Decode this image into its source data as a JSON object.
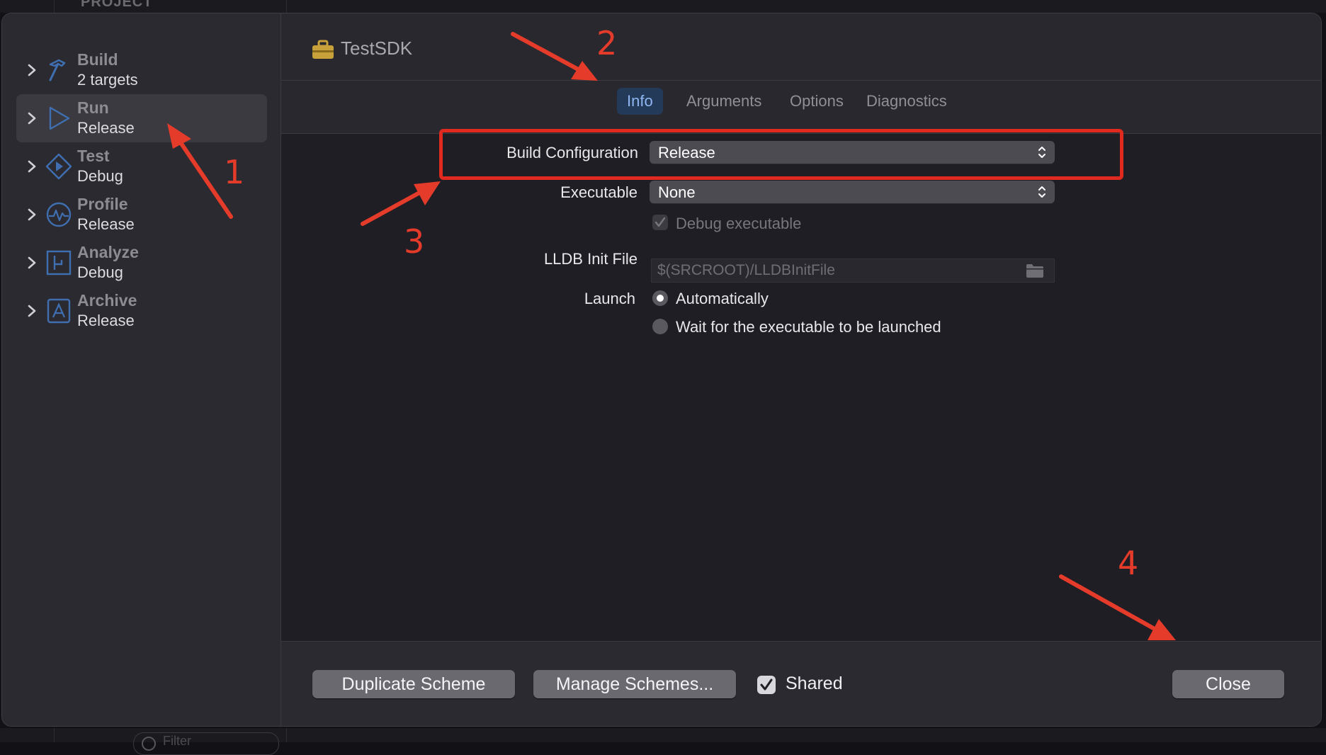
{
  "background": {
    "project_label": "PROJECT",
    "filter_placeholder": "Filter"
  },
  "sidebar": {
    "items": [
      {
        "title": "Build",
        "subtitle": "2 targets",
        "icon": "hammer-icon"
      },
      {
        "title": "Run",
        "subtitle": "Release",
        "icon": "play-icon",
        "selected": true
      },
      {
        "title": "Test",
        "subtitle": "Debug",
        "icon": "test-diamond-icon"
      },
      {
        "title": "Profile",
        "subtitle": "Release",
        "icon": "waveform-icon"
      },
      {
        "title": "Analyze",
        "subtitle": "Debug",
        "icon": "analyze-icon"
      },
      {
        "title": "Archive",
        "subtitle": "Release",
        "icon": "archive-icon"
      }
    ]
  },
  "header": {
    "scheme_name": "TestSDK"
  },
  "tabs": [
    {
      "label": "Info",
      "active": true
    },
    {
      "label": "Arguments"
    },
    {
      "label": "Options"
    },
    {
      "label": "Diagnostics"
    }
  ],
  "form": {
    "build_configuration_label": "Build Configuration",
    "build_configuration_value": "Release",
    "executable_label": "Executable",
    "executable_value": "None",
    "debug_executable_label": "Debug executable",
    "lldb_label": "LLDB Init File",
    "lldb_placeholder": "$(SRCROOT)/LLDBInitFile",
    "launch_label": "Launch",
    "launch_options": [
      "Automatically",
      "Wait for the executable to be launched"
    ],
    "launch_selected": "Automatically"
  },
  "footer": {
    "duplicate_label": "Duplicate Scheme",
    "manage_label": "Manage Schemes...",
    "shared_label": "Shared",
    "shared_checked": true,
    "close_label": "Close"
  },
  "annotations": {
    "step1": "1",
    "step2": "2",
    "step3": "3",
    "step4": "4",
    "color": "#e53b2a"
  },
  "colors": {
    "accent_tab": "#233a58",
    "accent_tab_text": "#8fb6f0",
    "sidebar_icon": "#3f6fb0"
  }
}
